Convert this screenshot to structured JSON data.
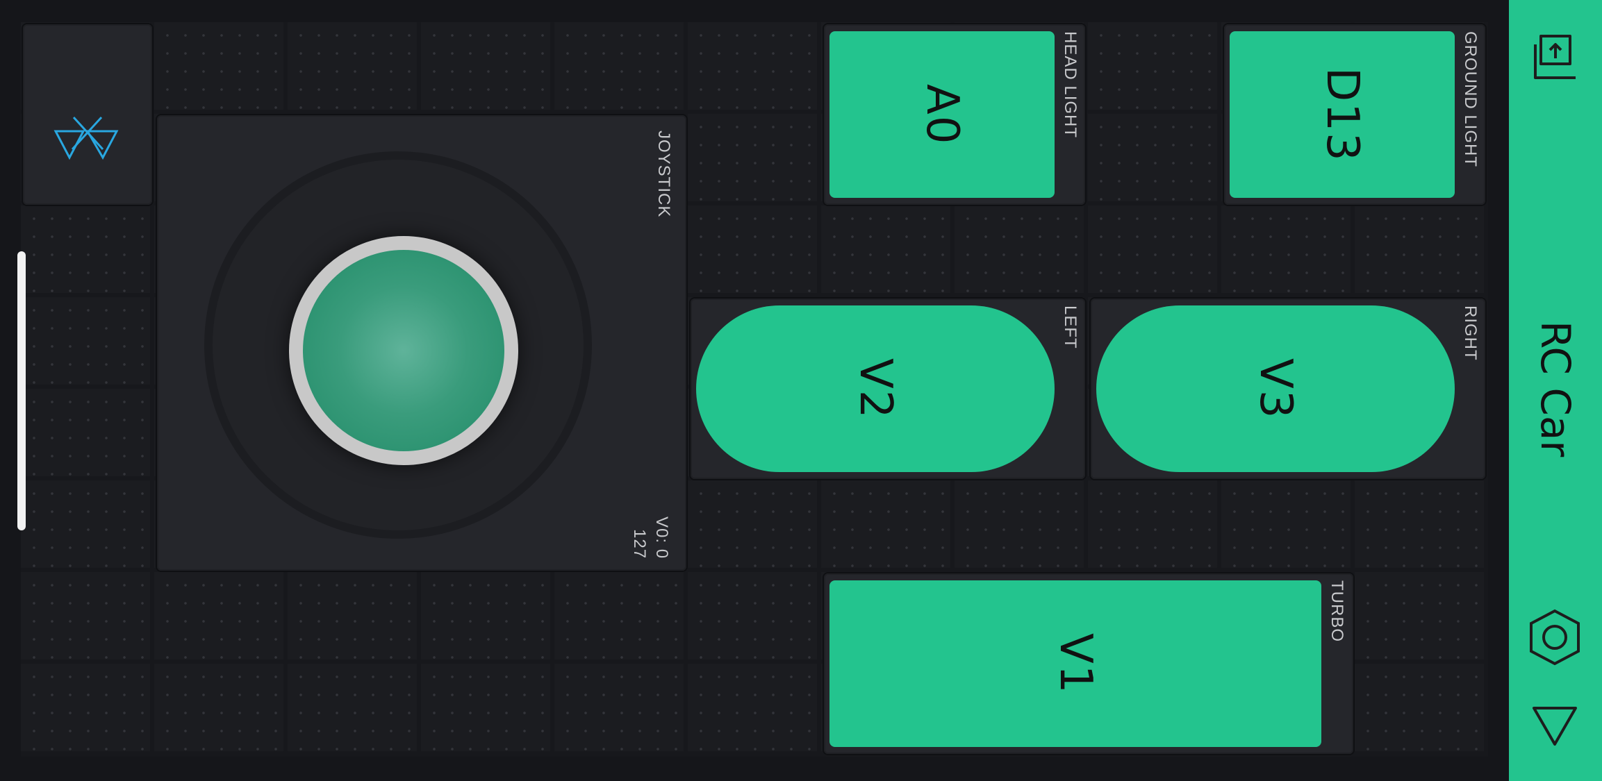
{
  "app": {
    "title": "RC Car",
    "accent_color": "#23c48e",
    "background_color": "#15161a"
  },
  "sidebar": {
    "icons": [
      "upload-icon",
      "settings-hexagon-icon",
      "play-triangle-icon"
    ]
  },
  "bluetooth_widget": {
    "icon": "bluetooth-icon",
    "icon_color": "#29a7e0"
  },
  "joystick": {
    "label": "JOYSTICK",
    "pin": "V0: 0",
    "value": "127"
  },
  "buttons": {
    "head_light": {
      "label": "HEAD LIGHT",
      "pin": "A0"
    },
    "ground_light": {
      "label": "GROUND LIGHT",
      "pin": "D13"
    },
    "left": {
      "label": "LEFT",
      "pin": "V2"
    },
    "right": {
      "label": "RIGHT",
      "pin": "V3"
    },
    "turbo": {
      "label": "TURBO",
      "pin": "V1"
    }
  }
}
